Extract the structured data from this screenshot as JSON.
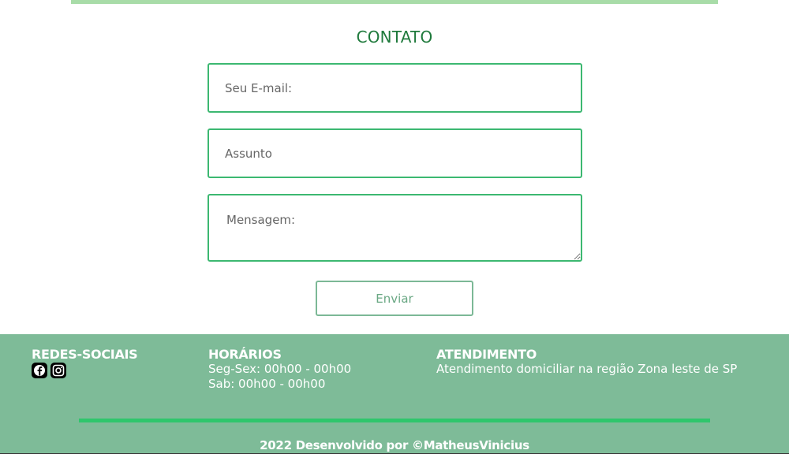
{
  "contact": {
    "title": "CONTATO",
    "email_placeholder": "Seu E-mail:",
    "subject_placeholder": "Assunto",
    "message_placeholder": "Mensagem:",
    "send_label": "Enviar"
  },
  "footer": {
    "social": {
      "heading": "REDES-SOCIAIS",
      "icons": [
        "facebook-icon",
        "instagram-icon"
      ]
    },
    "hours": {
      "heading": "HORÁRIOS",
      "weekdays": "Seg-Sex: 00h00 - 00h00",
      "saturday": "Sab: 00h00 - 00h00"
    },
    "service": {
      "heading": "ATENDIMENTO",
      "text": "Atendimento domiciliar na região Zona leste de SP"
    },
    "copyright": "2022 Desenvolvido por ©MatheusVinicius"
  },
  "colors": {
    "accent_green": "#3cb871",
    "title_green": "#1f7a3c",
    "footer_bg": "#7ebb98",
    "divider_green": "#2fc66c",
    "top_bar": "#a8dca8"
  }
}
